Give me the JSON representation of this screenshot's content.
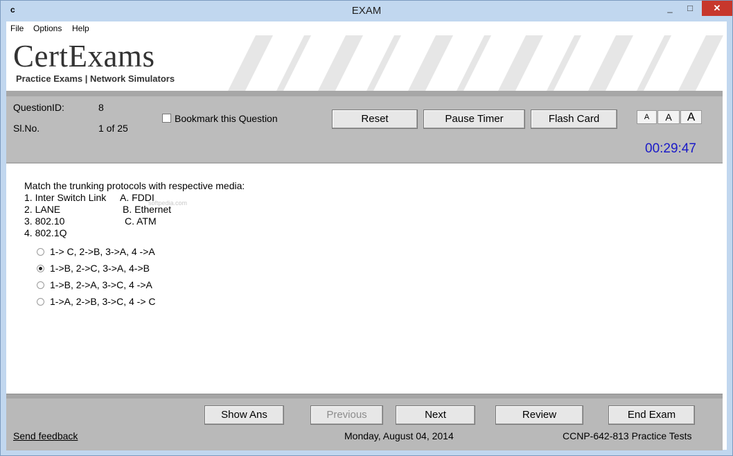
{
  "window": {
    "app_icon_letter": "c",
    "title": "EXAM",
    "controls": {
      "minimize": "_",
      "maximize": "□",
      "close": "✕"
    }
  },
  "menu": [
    "File",
    "Options",
    "Help"
  ],
  "banner": {
    "logo": "CertExams",
    "tagline": "Practice Exams | Network Simulators"
  },
  "info": {
    "question_id_label": "QuestionID:",
    "question_id_value": "8",
    "sl_no_label": "Sl.No.",
    "sl_no_value": "1 of 25",
    "bookmark_label": "Bookmark this Question",
    "bookmark_checked": false,
    "reset": "Reset",
    "pause_timer": "Pause Timer",
    "flash_card": "Flash Card",
    "font_small": "A",
    "font_medium": "A",
    "font_large": "A",
    "timer": "00:29:47",
    "timer_color": "#1a1ac8"
  },
  "question": {
    "stem": "Match the trunking protocols with respective media:",
    "left_items": [
      "1. Inter Switch Link",
      "2. LANE",
      "3. 802.10",
      "4. 802.1Q"
    ],
    "right_items": [
      "A. FDDI",
      "B. Ethernet",
      "C. ATM"
    ],
    "options": [
      {
        "label": "1-> C, 2->B, 3->A, 4 ->A",
        "selected": false
      },
      {
        "label": "1->B, 2->C, 3->A, 4->B",
        "selected": true
      },
      {
        "label": "1->B, 2->A, 3->C, 4 ->A",
        "selected": false
      },
      {
        "label": "1->A, 2->B, 3->C, 4 -> C",
        "selected": false
      }
    ],
    "watermark": "softpedia.com"
  },
  "footer": {
    "show_ans": "Show Ans",
    "previous": "Previous",
    "next": "Next",
    "review": "Review",
    "end_exam": "End Exam",
    "send_feedback": "Send feedback",
    "date": "Monday, August 04, 2014",
    "product": "CCNP-642-813 Practice Tests"
  }
}
